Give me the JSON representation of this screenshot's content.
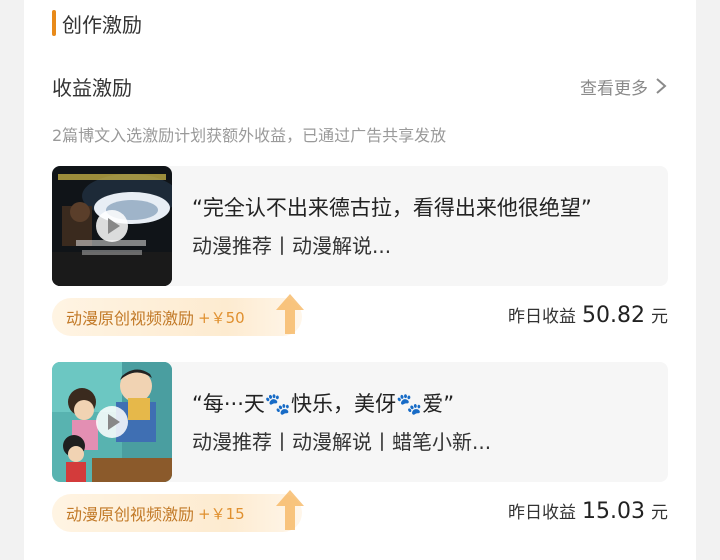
{
  "section": {
    "title": "创作激励"
  },
  "income": {
    "title": "收益激励",
    "more": "查看更多",
    "description": "2篇博文入选激励计划获额外收益，已通过广告共享发放"
  },
  "items": [
    {
      "title": "“完全认不出来德古拉，看得出来他很绝望”",
      "tags": "动漫推荐丨动漫解说...",
      "reward_label": "动漫原创视频激励",
      "reward_amount": "+￥50",
      "yesterday_label": "昨日收益",
      "yesterday_value": "50.82",
      "yesterday_unit": "元"
    },
    {
      "title": "“每···天🐾快乐，美伢🐾爱”",
      "tags": "动漫推荐丨动漫解说丨蜡笔小新...",
      "reward_label": "动漫原创视频激励",
      "reward_amount": "+￥15",
      "yesterday_label": "昨日收益",
      "yesterday_value": "15.03",
      "yesterday_unit": "元"
    }
  ],
  "colors": {
    "accent": "#e88a1a",
    "reward_text": "#c27a28"
  },
  "icons": {
    "more": "chevron-right-icon",
    "play": "play-icon",
    "reward": "up-arrow-icon"
  }
}
